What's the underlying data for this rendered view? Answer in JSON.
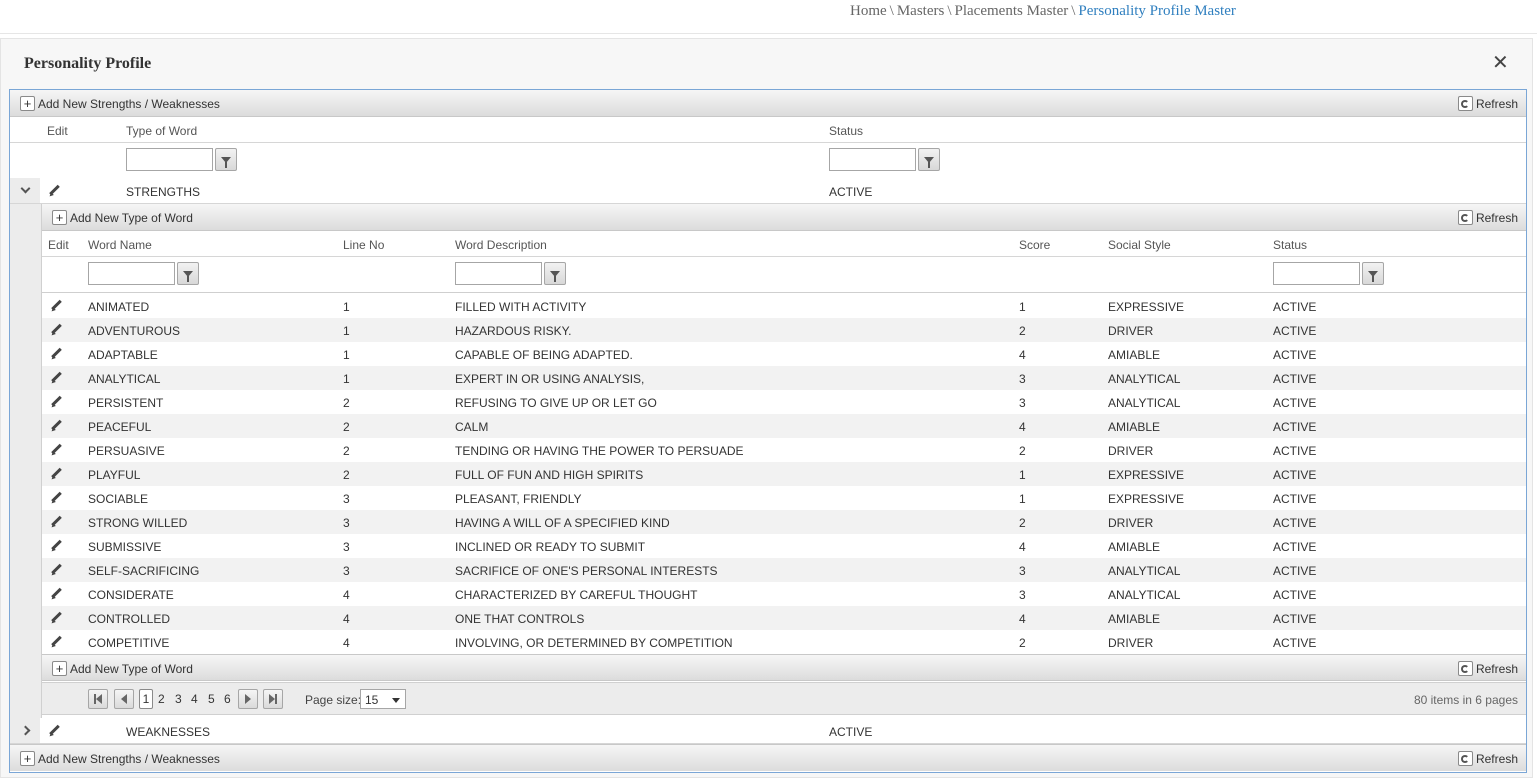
{
  "breadcrumb": {
    "items": [
      "Home",
      "Masters",
      "Placements Master"
    ],
    "current": "Personality Profile Master",
    "separator": "\\"
  },
  "panel": {
    "title": "Personality Profile",
    "close_label": "✕"
  },
  "master_toolbar": {
    "add_label": "Add New Strengths / Weaknesses",
    "refresh_label": "Refresh"
  },
  "master_columns": {
    "edit": "Edit",
    "type_of_word": "Type of Word",
    "status": "Status"
  },
  "master_rows": [
    {
      "type": "STRENGTHS",
      "status": "ACTIVE",
      "expanded": true
    },
    {
      "type": "WEAKNESSES",
      "status": "ACTIVE",
      "expanded": false
    }
  ],
  "detail_toolbar": {
    "add_label": "Add New Type of Word",
    "refresh_label": "Refresh"
  },
  "detail_columns": {
    "edit": "Edit",
    "word_name": "Word Name",
    "line_no": "Line No",
    "word_description": "Word Description",
    "score": "Score",
    "social_style": "Social Style",
    "status": "Status"
  },
  "detail_rows": [
    {
      "name": "ANIMATED",
      "line": "1",
      "desc": "FILLED WITH ACTIVITY",
      "score": "1",
      "style": "EXPRESSIVE",
      "status": "ACTIVE"
    },
    {
      "name": "ADVENTUROUS",
      "line": "1",
      "desc": "HAZARDOUS RISKY.",
      "score": "2",
      "style": "DRIVER",
      "status": "ACTIVE"
    },
    {
      "name": "ADAPTABLE",
      "line": "1",
      "desc": "CAPABLE OF BEING ADAPTED.",
      "score": "4",
      "style": "AMIABLE",
      "status": "ACTIVE"
    },
    {
      "name": "ANALYTICAL",
      "line": "1",
      "desc": "EXPERT IN OR USING ANALYSIS,",
      "score": "3",
      "style": "ANALYTICAL",
      "status": "ACTIVE"
    },
    {
      "name": "PERSISTENT",
      "line": "2",
      "desc": "REFUSING TO GIVE UP OR LET GO",
      "score": "3",
      "style": "ANALYTICAL",
      "status": "ACTIVE"
    },
    {
      "name": "PEACEFUL",
      "line": "2",
      "desc": "CALM",
      "score": "4",
      "style": "AMIABLE",
      "status": "ACTIVE"
    },
    {
      "name": "PERSUASIVE",
      "line": "2",
      "desc": "TENDING OR HAVING THE POWER TO PERSUADE",
      "score": "2",
      "style": "DRIVER",
      "status": "ACTIVE"
    },
    {
      "name": "PLAYFUL",
      "line": "2",
      "desc": "FULL OF FUN AND HIGH SPIRITS",
      "score": "1",
      "style": "EXPRESSIVE",
      "status": "ACTIVE"
    },
    {
      "name": "SOCIABLE",
      "line": "3",
      "desc": "PLEASANT, FRIENDLY",
      "score": "1",
      "style": "EXPRESSIVE",
      "status": "ACTIVE"
    },
    {
      "name": "STRONG WILLED",
      "line": "3",
      "desc": "HAVING A WILL OF A SPECIFIED KIND",
      "score": "2",
      "style": "DRIVER",
      "status": "ACTIVE"
    },
    {
      "name": "SUBMISSIVE",
      "line": "3",
      "desc": "INCLINED OR READY TO SUBMIT",
      "score": "4",
      "style": "AMIABLE",
      "status": "ACTIVE"
    },
    {
      "name": "SELF-SACRIFICING",
      "line": "3",
      "desc": "SACRIFICE OF ONE'S PERSONAL INTERESTS",
      "score": "3",
      "style": "ANALYTICAL",
      "status": "ACTIVE"
    },
    {
      "name": "CONSIDERATE",
      "line": "4",
      "desc": "CHARACTERIZED BY CAREFUL THOUGHT",
      "score": "3",
      "style": "ANALYTICAL",
      "status": "ACTIVE"
    },
    {
      "name": "CONTROLLED",
      "line": "4",
      "desc": "ONE THAT CONTROLS",
      "score": "4",
      "style": "AMIABLE",
      "status": "ACTIVE"
    },
    {
      "name": "COMPETITIVE",
      "line": "4",
      "desc": "INVOLVING, OR DETERMINED BY COMPETITION",
      "score": "2",
      "style": "DRIVER",
      "status": "ACTIVE"
    }
  ],
  "pager": {
    "pages": [
      "1",
      "2",
      "3",
      "4",
      "5",
      "6"
    ],
    "current_page": "1",
    "page_size_label": "Page size:",
    "page_size": "15",
    "info": "80 items in 6 pages"
  },
  "filters": {
    "type_of_word": "",
    "status": "",
    "word_name": "",
    "word_description": "",
    "detail_status": ""
  },
  "icons": {
    "add": "plus-icon",
    "refresh": "refresh-icon",
    "filter": "filter-icon",
    "edit": "pencil-icon",
    "close": "close-icon"
  },
  "colors": {
    "breadcrumb_current": "#2f7fbf",
    "grid_border": "#7aa6d6"
  }
}
